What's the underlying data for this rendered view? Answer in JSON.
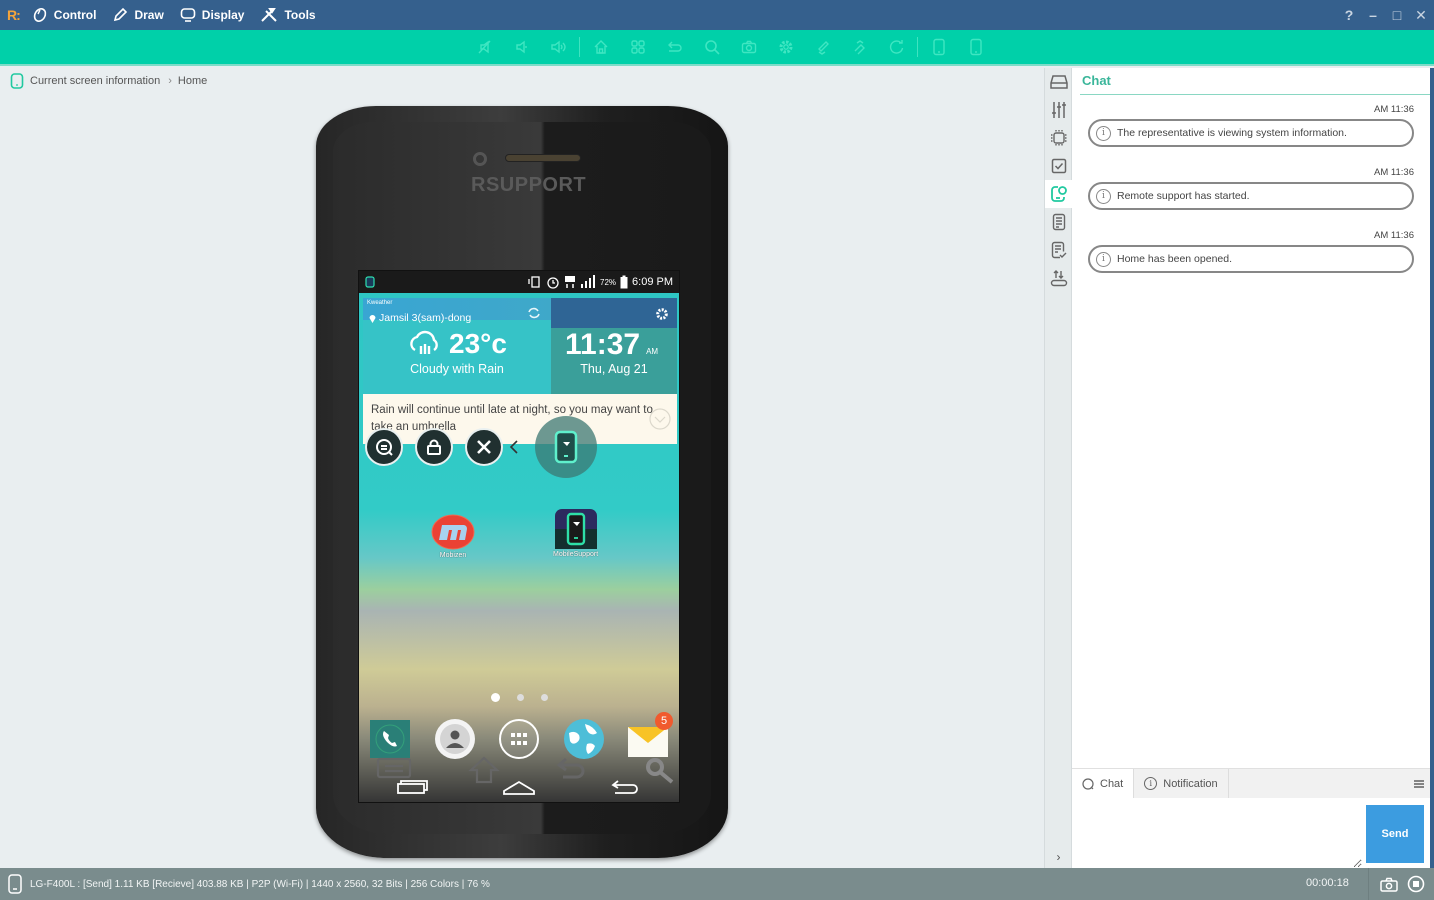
{
  "titlebar": {
    "logo": "R:",
    "menus": [
      {
        "label": "Control",
        "icon": "mouse-icon"
      },
      {
        "label": "Draw",
        "icon": "pen-icon"
      },
      {
        "label": "Display",
        "icon": "monitor-icon"
      },
      {
        "label": "Tools",
        "icon": "tools-icon"
      }
    ],
    "window_controls": [
      "?",
      "–",
      "□",
      "✕"
    ]
  },
  "toolbar": {
    "tools": [
      "mute-icon",
      "volume-down-icon",
      "volume-up-icon",
      "home-icon",
      "apps-icon",
      "back-icon",
      "search-icon",
      "camera-icon",
      "settings-icon",
      "pen-down-icon",
      "pen-up-icon",
      "refresh-icon",
      "phone-portrait-icon",
      "phone-landscape-icon"
    ]
  },
  "breadcrumb": {
    "root": "Current screen information",
    "current": "Home"
  },
  "device": {
    "brand": "RSUPPORT",
    "statusbar": {
      "battery": "72%",
      "time": "6:09 PM"
    },
    "weather": {
      "provider": "Kweather",
      "location": "Jamsil 3(sam)-dong",
      "temperature": "23°c",
      "condition": "Cloudy with Rain",
      "clock": "11:37",
      "ampm": "AM",
      "date": "Thu, Aug 21",
      "forecast": "Rain will continue until late at night, so you may want to take an umbrella"
    },
    "apps": [
      {
        "label": "Mobizen"
      },
      {
        "label": "MobileSupport"
      }
    ],
    "page_indicator": {
      "pages": 3,
      "current": 1
    },
    "dock": [
      {
        "name": "Phone"
      },
      {
        "name": "Contacts"
      },
      {
        "name": "Apps"
      },
      {
        "name": "Internet"
      },
      {
        "name": "Email",
        "badge": "5"
      }
    ]
  },
  "side_tabs": [
    "storage-icon",
    "equalizer-icon",
    "chip-icon",
    "checkbox-icon",
    "chat-user-icon",
    "document-icon",
    "document-check-icon",
    "transfer-icon"
  ],
  "chat": {
    "title": "Chat",
    "messages": [
      {
        "time": "AM 11:36",
        "text": "The representative is viewing system information."
      },
      {
        "time": "AM 11:36",
        "text": "Remote support has started."
      },
      {
        "time": "AM 11:36",
        "text": "Home has been opened."
      }
    ],
    "tabs": [
      {
        "label": "Chat",
        "active": true
      },
      {
        "label": "Notification",
        "active": false
      }
    ],
    "input_value": "",
    "send_label": "Send"
  },
  "status": {
    "info": "LG-F400L : [Send] 1.11 KB  [Recieve] 403.88 KB | P2P (Wi-Fi) | 1440 x 2560, 32 Bits | 256 Colors | 76 %",
    "timer": "00:00:18"
  },
  "colors": {
    "titlebar": "#35608d",
    "toolbar": "#00d0a9",
    "accent": "#3ab69a",
    "send": "#3c9ce0",
    "statusbar": "#7a8c8d",
    "logo": "#f4a43a"
  }
}
